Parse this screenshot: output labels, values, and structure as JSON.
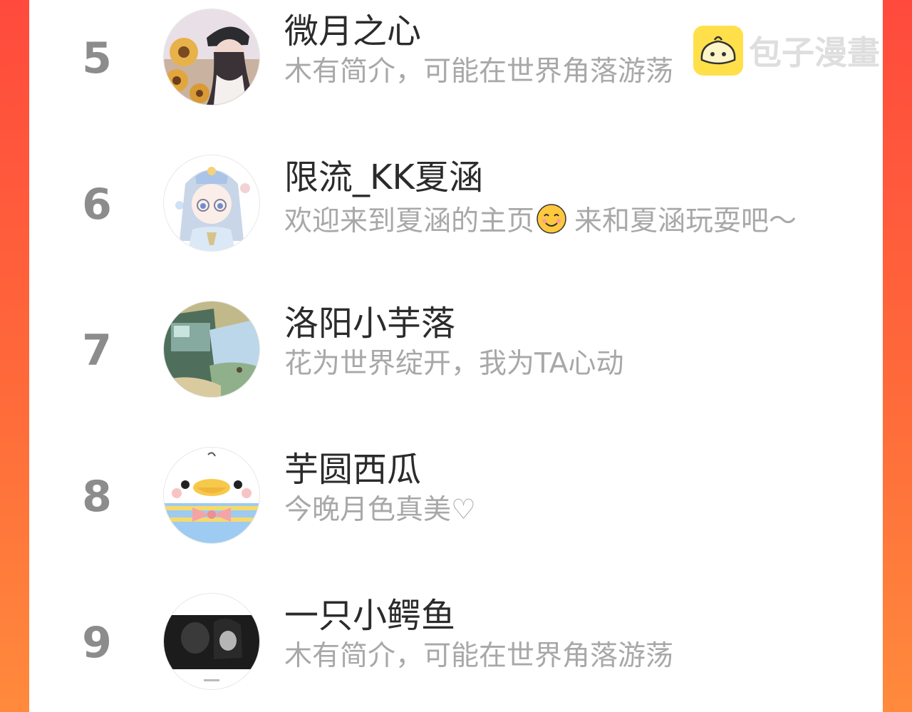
{
  "watermark": {
    "text": "包子漫畫",
    "logo_icon": "bun-mascot-icon"
  },
  "ranking": [
    {
      "rank": "5",
      "name": "微月之心",
      "bio": "木有简介，可能在世界角落游荡",
      "avatar_icon": "girl-with-sunflowers-avatar"
    },
    {
      "rank": "6",
      "name": "限流_KK夏涵",
      "bio_before": "欢迎来到夏涵的主页",
      "bio_emoji": "smiling-face-emoji",
      "bio_after": "来和夏涵玩耍吧～",
      "avatar_icon": "anime-girl-avatar"
    },
    {
      "rank": "7",
      "name": "洛阳小芋落",
      "bio": "花为世界绽开，我为TA心动",
      "avatar_icon": "landscape-collage-avatar"
    },
    {
      "rank": "8",
      "name": "芋圆西瓜",
      "bio": "今晚月色真美♡",
      "avatar_icon": "cartoon-duck-avatar"
    },
    {
      "rank": "9",
      "name": "一只小鳄鱼",
      "bio": "木有简介，可能在世界角落游荡",
      "avatar_icon": "couple-photo-avatar"
    }
  ]
}
